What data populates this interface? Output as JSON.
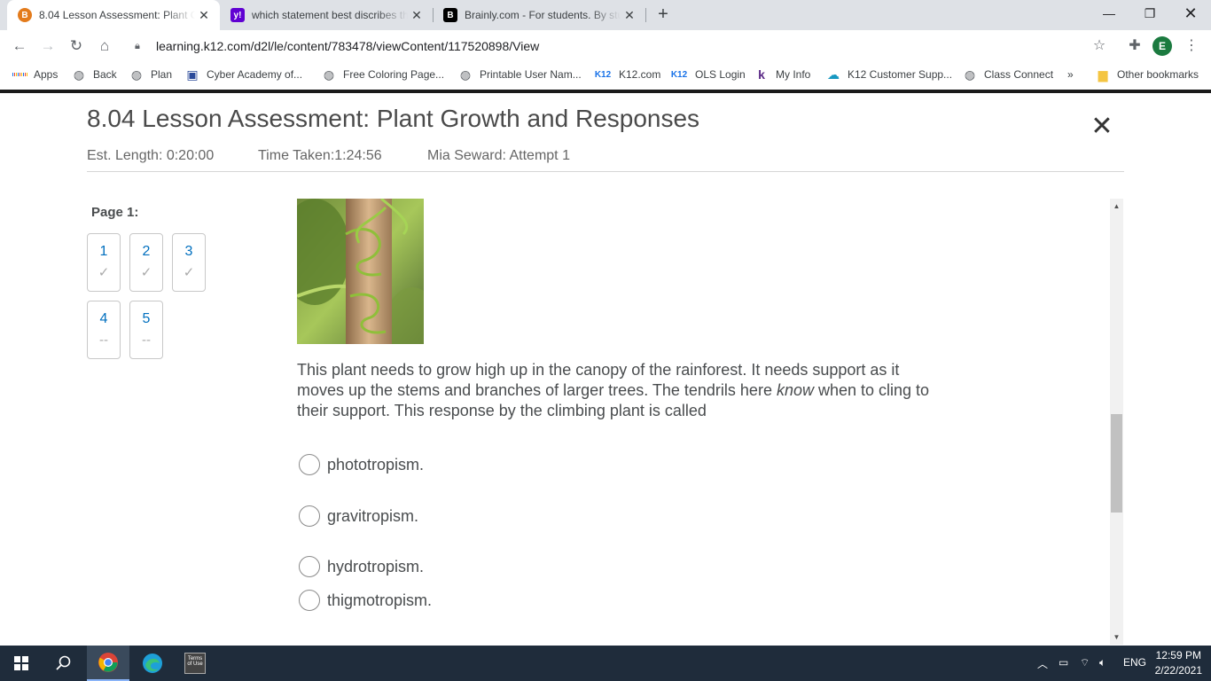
{
  "browser": {
    "tabs": [
      {
        "title": "8.04 Lesson Assessment: Plant Gr",
        "active": true,
        "favicon": "k12-favicon"
      },
      {
        "title": "which statement best discribes th",
        "active": false,
        "favicon": "yahoo-favicon"
      },
      {
        "title": "Brainly.com - For students. By stu",
        "active": false,
        "favicon": "brainly-favicon"
      }
    ],
    "url": "learning.k12.com/d2l/le/content/783478/viewContent/117520898/View",
    "profile_initial": "E",
    "bookmarks": [
      {
        "label": "Apps",
        "icon": "apps-grid-icon"
      },
      {
        "label": "Back",
        "icon": "globe-icon"
      },
      {
        "label": "Plan",
        "icon": "globe-icon"
      },
      {
        "label": "Cyber Academy of...",
        "icon": "calendar-icon"
      },
      {
        "label": "Free Coloring Page...",
        "icon": "globe-icon"
      },
      {
        "label": "Printable User Nam...",
        "icon": "globe-icon"
      },
      {
        "label": "K12.com",
        "icon": "k12-icon"
      },
      {
        "label": "OLS Login",
        "icon": "k12-icon"
      },
      {
        "label": "My Info",
        "icon": "k12-icon"
      },
      {
        "label": "K12 Customer Supp...",
        "icon": "cloud-icon"
      },
      {
        "label": "Class Connect",
        "icon": "globe-icon"
      }
    ],
    "more_bookmarks": "»",
    "other_bookmarks": "Other bookmarks"
  },
  "assessment": {
    "title": "8.04 Lesson Assessment: Plant Growth and Responses",
    "est_length": "Est. Length: 0:20:00",
    "time_taken": "Time Taken:1:24:56",
    "attempt": "Mia Seward: Attempt 1",
    "page_label": "Page 1:",
    "questions": [
      {
        "number": "1",
        "status": "✓"
      },
      {
        "number": "2",
        "status": "✓"
      },
      {
        "number": "3",
        "status": "✓"
      },
      {
        "number": "4",
        "status": "--"
      },
      {
        "number": "5",
        "status": "--"
      }
    ],
    "question_text_1": "This plant needs to grow high up in the canopy of the rainforest. It needs support as it moves up the stems and branches of larger trees. The tendrils here ",
    "question_text_em": "know",
    "question_text_2": " when to cling to their support. This response by the climbing plant is called",
    "options": [
      "phototropism.",
      "gravitropism.",
      "hydrotropism.",
      "thigmotropism."
    ]
  },
  "taskbar": {
    "time": "12:59 PM",
    "date": "2/22/2021",
    "language": "ENG",
    "terms_app": "Terms of Use"
  },
  "colors": {
    "tab_strip": "#dee1e6",
    "taskbar": "#1f2c3b",
    "question_number": "#006fbf",
    "body_text": "#494c4e"
  }
}
